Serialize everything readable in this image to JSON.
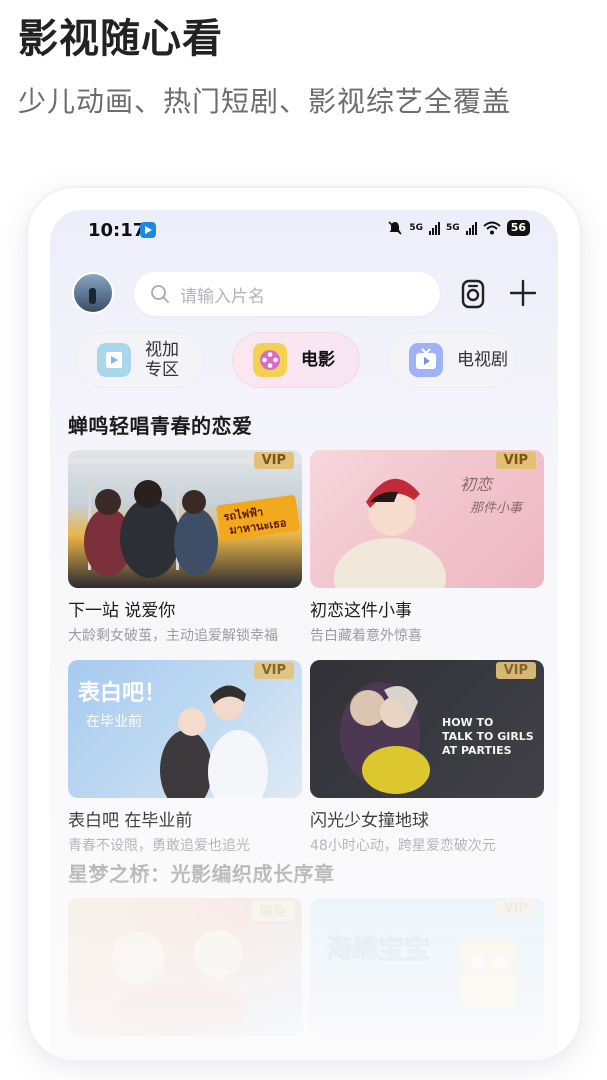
{
  "hero": {
    "headline": "影视随心看",
    "subhead": "少儿动画、热门短剧、影视综艺全覆盖"
  },
  "status_bar": {
    "time": "10:17",
    "network_1": "5G",
    "network_2": "5G",
    "battery": "56"
  },
  "top_bar": {
    "search_placeholder": "请输入片名"
  },
  "chips": [
    {
      "label_line1": "视加",
      "label_line2": "专区",
      "icon": "film-frame-icon",
      "color": "#a9d6e8"
    },
    {
      "label": "电影",
      "icon": "film-reel-icon",
      "color": "#d96bd0",
      "active": true
    },
    {
      "label": "电视剧",
      "icon": "tv-play-icon",
      "color": "#7a8ef0"
    }
  ],
  "sections": [
    {
      "title": "蝉鸣轻唱青春的恋爱",
      "cards": [
        {
          "title": "下一站 说爱你",
          "desc": "大龄剩女破茧，主动追爱解锁幸福",
          "badge": "VIP",
          "poster_text": "รถไฟฟ้า มาหานะเธอ"
        },
        {
          "title": "初恋这件小事",
          "desc": "告白藏着意外惊喜",
          "badge": "VIP",
          "poster_text": "初恋 那件小事"
        },
        {
          "title": "表白吧 在毕业前",
          "desc": "青春不设限，勇敢追爱也追光",
          "badge": "VIP",
          "poster_text": "表白吧！在毕业前"
        },
        {
          "title": "闪光少女撞地球",
          "desc": "48小时心动，跨星爱恋破次元",
          "badge": "VIP",
          "poster_text": "HOW TO TALK TO GIRLS AT PARTIES"
        }
      ]
    },
    {
      "title": "星梦之桥：光影编织成长序章",
      "cards": [
        {
          "badge": "限免",
          "poster_text": ""
        },
        {
          "badge": "VIP",
          "poster_text": "海绵宝宝"
        }
      ]
    }
  ],
  "colors": {
    "vip_badge": "#e2be6e",
    "accent_pink": "#f7e4f4",
    "search_bg": "#ffffff"
  }
}
